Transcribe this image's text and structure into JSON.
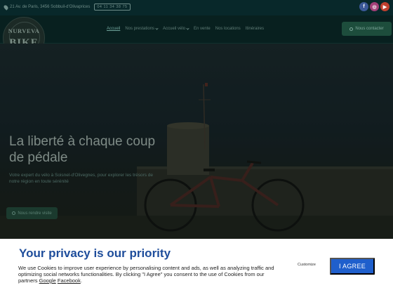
{
  "topbar": {
    "address": "21 Av. de Paris, 3456 Sobbuil-d'Olivaprices",
    "phone": "04 11 34 38 75",
    "social": {
      "facebook": "f",
      "instagram": "◎",
      "youtube": "▶"
    }
  },
  "logo": {
    "line1": "NURVEVA",
    "line2": "BIKE"
  },
  "nav": {
    "items": [
      {
        "label": "Accueil",
        "active": true,
        "dropdown": false
      },
      {
        "label": "Nos prestations",
        "active": false,
        "dropdown": true
      },
      {
        "label": "Accueil vélo",
        "active": false,
        "dropdown": true
      },
      {
        "label": "En vente",
        "active": false,
        "dropdown": false
      },
      {
        "label": "Nos locations",
        "active": false,
        "dropdown": false
      },
      {
        "label": "Itinéraires",
        "active": false,
        "dropdown": false
      }
    ],
    "cta": "Nous contacter"
  },
  "hero": {
    "title": "La liberté à chaque coup de pédale",
    "text": "Votre expert du vélo à Soisnel-d'Olivegnes, pour explorer les trésors de notre région en toute sérénité",
    "button": "Nous rendre visite"
  },
  "cookie": {
    "heading": "Your privacy is our priority",
    "body": "We use Cookies to improve user experience by personalising content and ads, as well as analyzing traffic and optimizing social networks functionalities. By clicking \"I Agree\" you consent to the use of Cookies from our partners",
    "link_google": "Google",
    "link_facebook": "Facebook",
    "customize": "Customize",
    "agree": "I AGREE"
  },
  "colors": {
    "accent": "#1f5fcc",
    "heading": "#1e4d9b",
    "brand_green": "#1d4d3c"
  }
}
